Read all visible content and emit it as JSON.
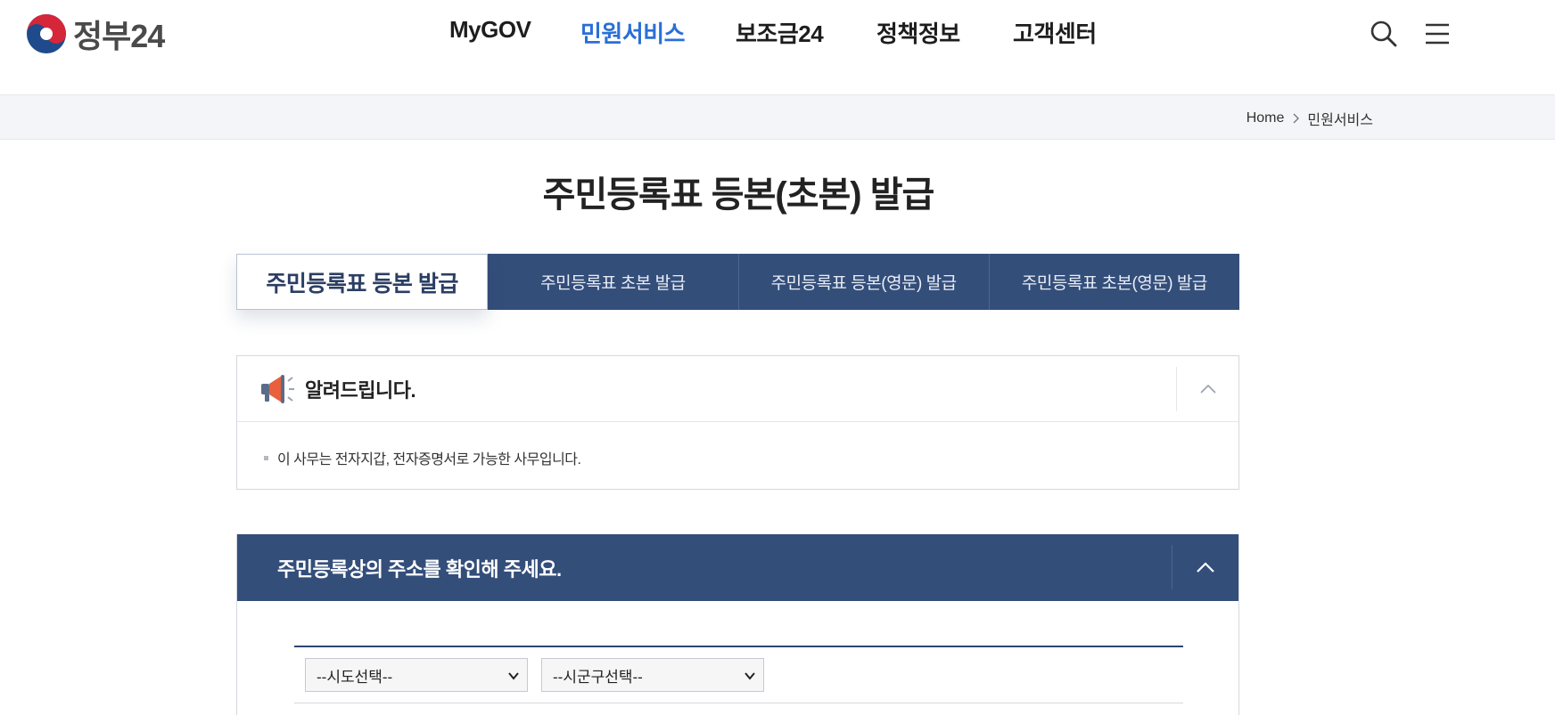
{
  "header": {
    "logo_text": "정부24",
    "nav": [
      {
        "label": "MyGOV",
        "active": false
      },
      {
        "label": "민원서비스",
        "active": true
      },
      {
        "label": "보조금24",
        "active": false
      },
      {
        "label": "정책정보",
        "active": false
      },
      {
        "label": "고객센터",
        "active": false
      }
    ],
    "icons": [
      "search-icon",
      "menu-icon"
    ]
  },
  "breadcrumb": {
    "home": "Home",
    "current": "민원서비스"
  },
  "page": {
    "title": "주민등록표 등본(초본) 발급"
  },
  "tabs": [
    {
      "label": "주민등록표 등본 발급",
      "active": true
    },
    {
      "label": "주민등록표 초본 발급",
      "active": false
    },
    {
      "label": "주민등록표 등본(영문) 발급",
      "active": false
    },
    {
      "label": "주민등록표 초본(영문) 발급",
      "active": false
    }
  ],
  "notice": {
    "icon": "megaphone-icon",
    "title": "알려드립니다.",
    "items": [
      "이 사무는 전자지갑, 전자증명서로 가능한 사무입니다."
    ]
  },
  "address": {
    "title": "주민등록상의 주소를 확인해 주세요.",
    "sido_select": "--시도선택--",
    "sigungu_select": "--시군구선택--"
  },
  "colors": {
    "primary_navy": "#344e7a",
    "active_nav_blue": "#2a6fd6",
    "logo_red": "#d6263a",
    "logo_blue": "#1f4a8c"
  }
}
